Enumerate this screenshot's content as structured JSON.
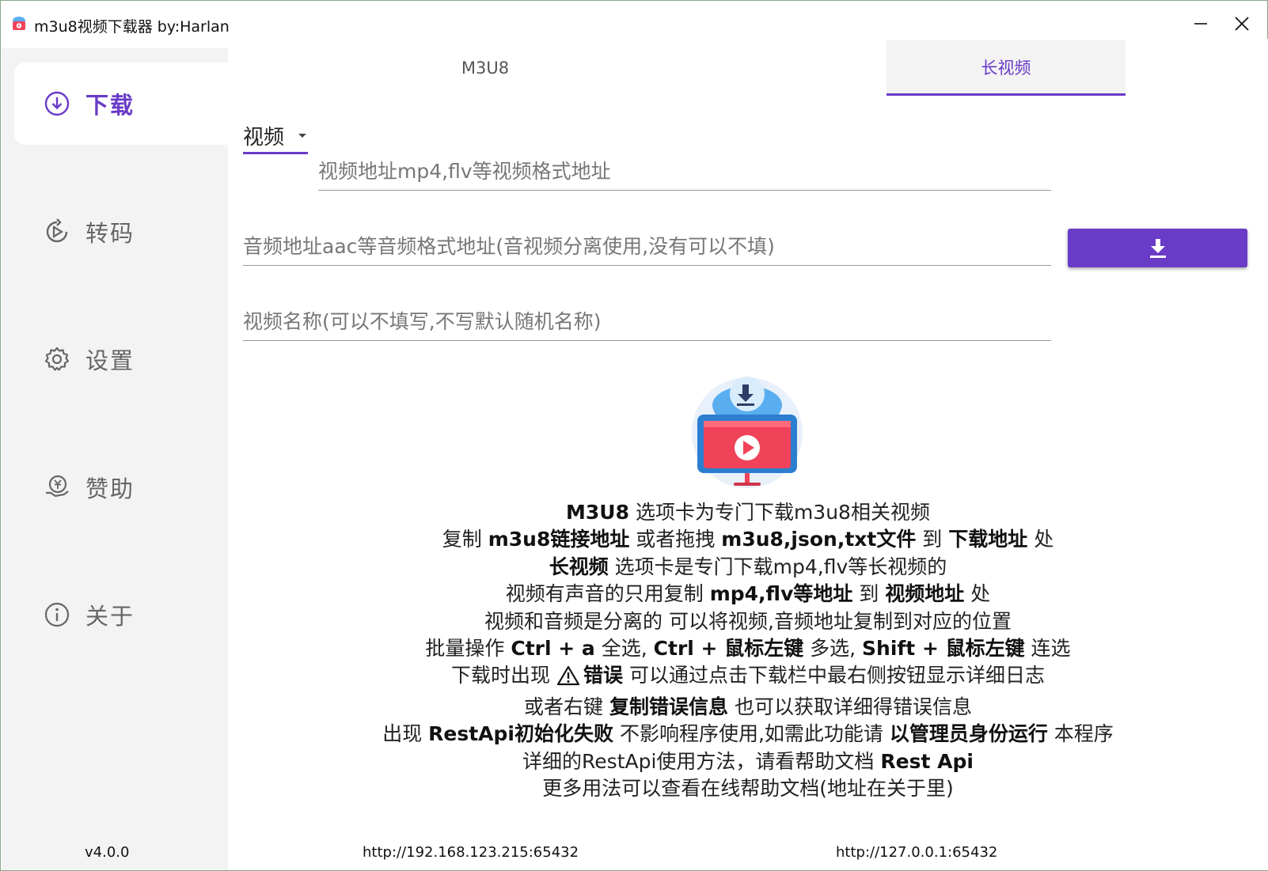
{
  "window": {
    "title": "m3u8视频下载器 by:Harlan",
    "minimize_glyph": "—",
    "close_glyph": "✕"
  },
  "sidebar": {
    "items": [
      {
        "label": "下载",
        "icon": "download-circle-icon",
        "active": true
      },
      {
        "label": "转码",
        "icon": "transcode-icon",
        "active": false
      },
      {
        "label": "设置",
        "icon": "gear-icon",
        "active": false
      },
      {
        "label": "赞助",
        "icon": "sponsor-icon",
        "active": false
      },
      {
        "label": "关于",
        "icon": "info-icon",
        "active": false
      }
    ],
    "version": "v4.0.0"
  },
  "tabs": {
    "m3u8": "M3U8",
    "long_video": "长视频",
    "active": "long_video"
  },
  "form": {
    "type_select": {
      "value": "视频"
    },
    "video_url": {
      "value": "",
      "placeholder": "视频地址mp4,flv等视频格式地址"
    },
    "audio_url": {
      "value": "",
      "placeholder": "音频地址aac等音频格式地址(音视频分离使用,没有可以不填)"
    },
    "video_name": {
      "value": "",
      "placeholder": "视频名称(可以不填写,不写默认随机名称)"
    },
    "download_icon": "download-arrow-icon"
  },
  "help": {
    "l1": {
      "b1": "M3U8",
      "t1": " 选项卡为专门下载m3u8相关视频"
    },
    "l2": {
      "t1": "复制 ",
      "b1": "m3u8链接地址",
      "t2": " 或者拖拽 ",
      "b2": "m3u8,json,txt文件",
      "t3": " 到 ",
      "b3": "下载地址",
      "t4": " 处"
    },
    "l3": {
      "b1": "长视频",
      "t1": " 选项卡是专门下载mp4,flv等长视频的"
    },
    "l4": {
      "t1": "视频有声音的只用复制 ",
      "b1": "mp4,flv等地址",
      "t2": " 到 ",
      "b2": "视频地址",
      "t3": " 处"
    },
    "l5": {
      "t1": "视频和音频是分离的 可以将视频,音频地址复制到对应的位置"
    },
    "l6": {
      "t1": "批量操作 ",
      "b1": "Ctrl + a",
      "t2": " 全选, ",
      "b2": "Ctrl + 鼠标左键",
      "t3": " 多选, ",
      "b3": "Shift + 鼠标左键",
      "t4": " 连选"
    },
    "l7": {
      "t1": "下载时出现",
      "b1": "错误",
      "t2": " 可以通过点击下载栏中最右侧按钮显示详细日志"
    },
    "l8": {
      "t1": "或者右键 ",
      "b1": "复制错误信息",
      "t2": " 也可以获取详细得错误信息"
    },
    "l9": {
      "t1": "出现 ",
      "b1": "RestApi初始化失败",
      "t2": " 不影响程序使用,如需此功能请 ",
      "b2": "以管理员身份运行",
      "t3": " 本程序"
    },
    "l10": {
      "t1": "详细的RestApi使用方法，请看帮助文档 ",
      "b1": "Rest Api"
    },
    "l11": {
      "t1": "更多用法可以查看在线帮助文档(地址在关于里)"
    }
  },
  "footer": {
    "lan_url": "http://192.168.123.215:65432",
    "local_url": "http://127.0.0.1:65432"
  },
  "colors": {
    "accent": "#6a3bc7",
    "sidebar_bg": "#f3f3f3",
    "hero_cloud": "#5aaef0",
    "hero_screen": "#f0435a"
  }
}
